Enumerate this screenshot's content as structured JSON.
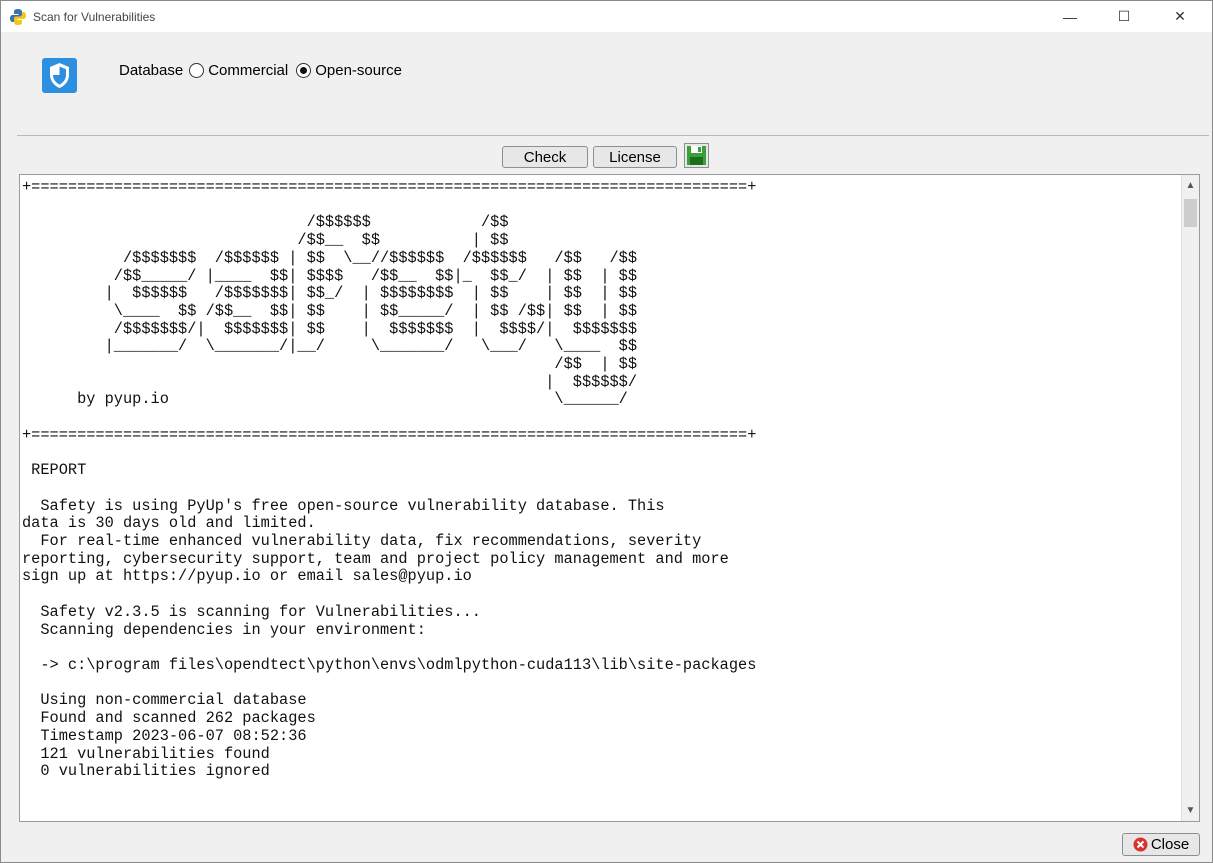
{
  "window": {
    "title": "Scan for Vulnerabilities",
    "minimize_glyph": "—",
    "maximize_glyph": "☐",
    "close_glyph": "✕"
  },
  "database": {
    "label": "Database",
    "options": [
      "Commercial",
      "Open-source"
    ],
    "selected": "Open-source"
  },
  "toolbar": {
    "check_label": "Check",
    "license_label": "License",
    "save_icon": "save-icon"
  },
  "output": {
    "text": "+==============================================================================+\n\n                               /$$$$$$            /$$\n                              /$$__  $$          | $$\n           /$$$$$$$  /$$$$$$ | $$  \\__//$$$$$$  /$$$$$$   /$$   /$$\n          /$$_____/ |____  $$| $$$$   /$$__  $$|_  $$_/  | $$  | $$\n         |  $$$$$$   /$$$$$$$| $$_/  | $$$$$$$$  | $$    | $$  | $$\n          \\____  $$ /$$__  $$| $$    | $$_____/  | $$ /$$| $$  | $$\n          /$$$$$$$/|  $$$$$$$| $$    |  $$$$$$$  |  $$$$/|  $$$$$$$\n         |_______/  \\_______/|__/     \\_______/   \\___/   \\____  $$\n                                                          /$$  | $$\n                                                         |  $$$$$$/\n      by pyup.io                                          \\______/\n\n+==============================================================================+\n\n REPORT\n\n  Safety is using PyUp's free open-source vulnerability database. This\ndata is 30 days old and limited.\n  For real-time enhanced vulnerability data, fix recommendations, severity\nreporting, cybersecurity support, team and project policy management and more\nsign up at https://pyup.io or email sales@pyup.io\n\n  Safety v2.3.5 is scanning for Vulnerabilities...\n  Scanning dependencies in your environment:\n\n  -> c:\\program files\\opendtect\\python\\envs\\odmlpython-cuda113\\lib\\site-packages\n\n  Using non-commercial database\n  Found and scanned 262 packages\n  Timestamp 2023-06-07 08:52:36\n  121 vulnerabilities found\n  0 vulnerabilities ignored"
  },
  "footer": {
    "close_label": "Close"
  },
  "colors": {
    "shield_blue": "#2d8fe0",
    "save_green": "#3aa13a",
    "close_red": "#d9342b"
  }
}
